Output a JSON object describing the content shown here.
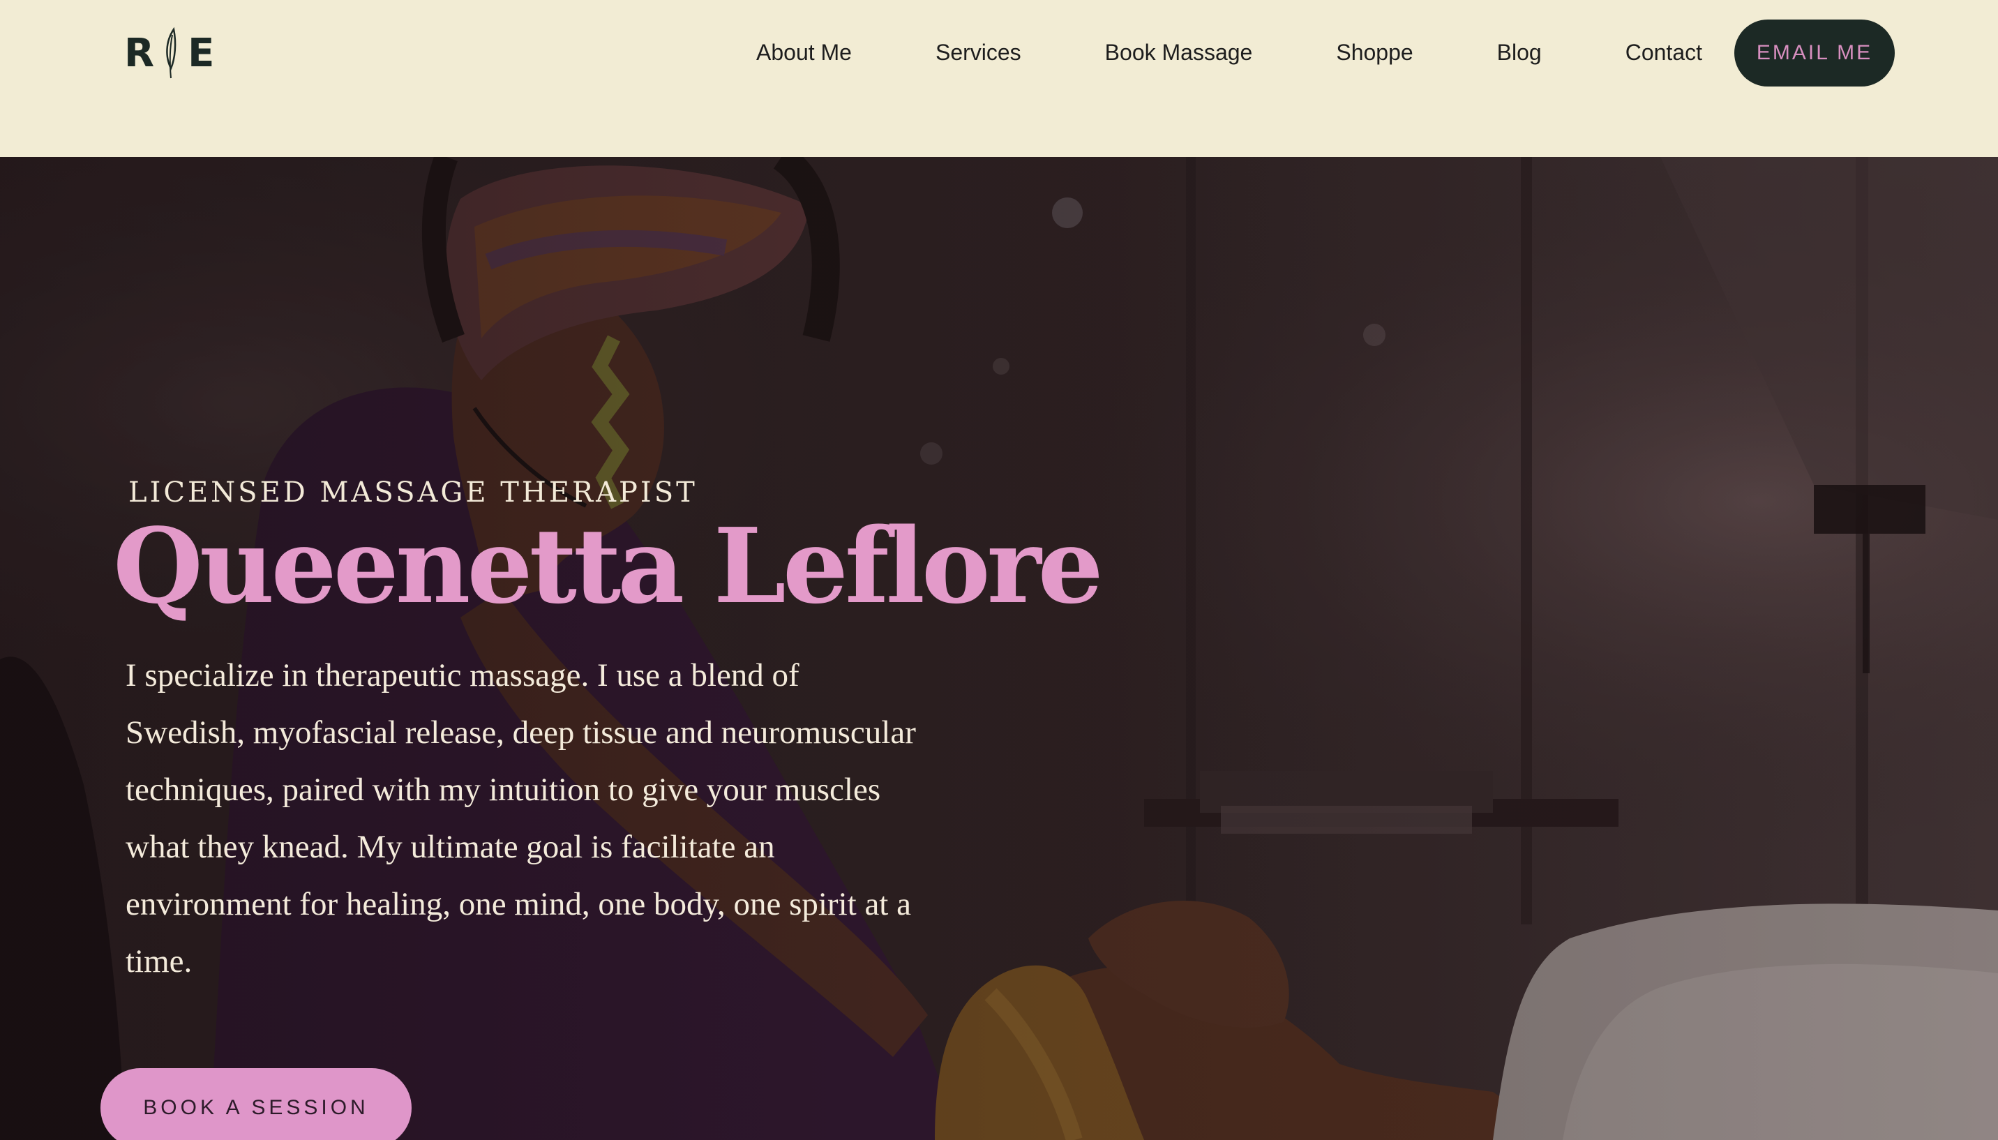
{
  "header": {
    "logo_left": "R",
    "logo_right": "E",
    "nav": [
      {
        "label": "About Me"
      },
      {
        "label": "Services"
      },
      {
        "label": "Book Massage"
      },
      {
        "label": "Shoppe"
      },
      {
        "label": "Blog"
      },
      {
        "label": "Contact"
      }
    ],
    "cta_label": "EMAIL ME"
  },
  "hero": {
    "eyebrow": "LICENSED MASSAGE THERAPIST",
    "name": "Queenetta Leflore",
    "bio": "I specialize in therapeutic massage. I use a blend of Swedish, myofascial release, deep tissue and neuromuscular techniques, paired with my intuition to give your muscles what they knead. My ultimate goal is facilitate an environment for healing, one mind, one body, one spirit at a time.",
    "cta_label": "BOOK A SESSION"
  },
  "colors": {
    "header_bg": "#f2ecd4",
    "dark_green": "#1c2925",
    "accent_pink": "#df96c9",
    "hero_text": "#f4ebdb"
  }
}
